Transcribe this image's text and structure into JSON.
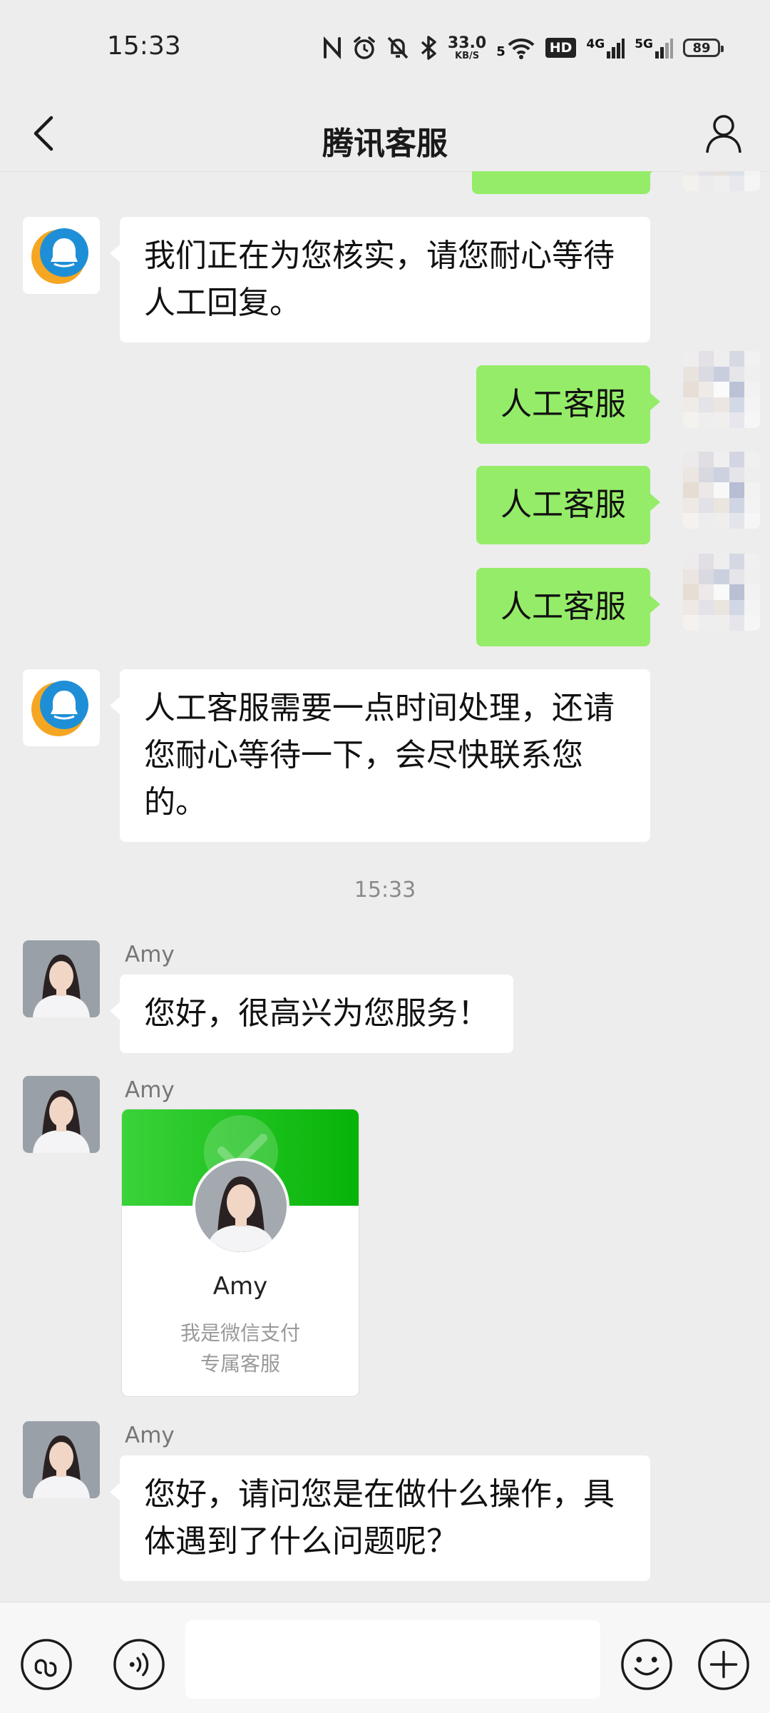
{
  "status_bar": {
    "time": "15:33",
    "net_speed": "33.0",
    "net_speed_unit": "KB/S",
    "wifi_label": "5",
    "hd_label": "HD",
    "signal1_label": "4G",
    "signal2_label": "5G",
    "battery": "89"
  },
  "nav": {
    "title": "腾讯客服"
  },
  "messages": [
    {
      "from": "service",
      "text": "我们正在为您核实，请您耐心等待人工回复。"
    },
    {
      "from": "me",
      "text": "人工客服"
    },
    {
      "from": "me",
      "text": "人工客服"
    },
    {
      "from": "me",
      "text": "人工客服"
    },
    {
      "from": "service",
      "text": "人工客服需要一点时间处理，还请您耐心等待一下，会尽快联系您的。"
    },
    {
      "type": "timestamp",
      "text": "15:33"
    },
    {
      "from": "agent",
      "sender": "Amy",
      "text": "您好，很高兴为您服务！"
    },
    {
      "from": "agent",
      "sender": "Amy",
      "type": "card",
      "card_name": "Amy",
      "card_desc_line1": "我是微信支付",
      "card_desc_line2": "专属客服"
    },
    {
      "from": "agent",
      "sender": "Amy",
      "text": "您好，请问您是在做什么操作，具体遇到了什么问题呢？"
    }
  ],
  "input": {
    "value": "",
    "placeholder": ""
  },
  "icons": {
    "back": "chevron-left-icon",
    "profile": "person-icon",
    "mini_program": "link-icon",
    "voice": "voice-icon",
    "emoji": "smile-icon",
    "more": "plus-icon"
  },
  "colors": {
    "my_bubble": "#95ec69",
    "other_bubble": "#ffffff",
    "background": "#ededed",
    "card_header": "#07b307",
    "service_logo_blue": "#1e8fd6",
    "service_logo_orange": "#f5a623"
  }
}
